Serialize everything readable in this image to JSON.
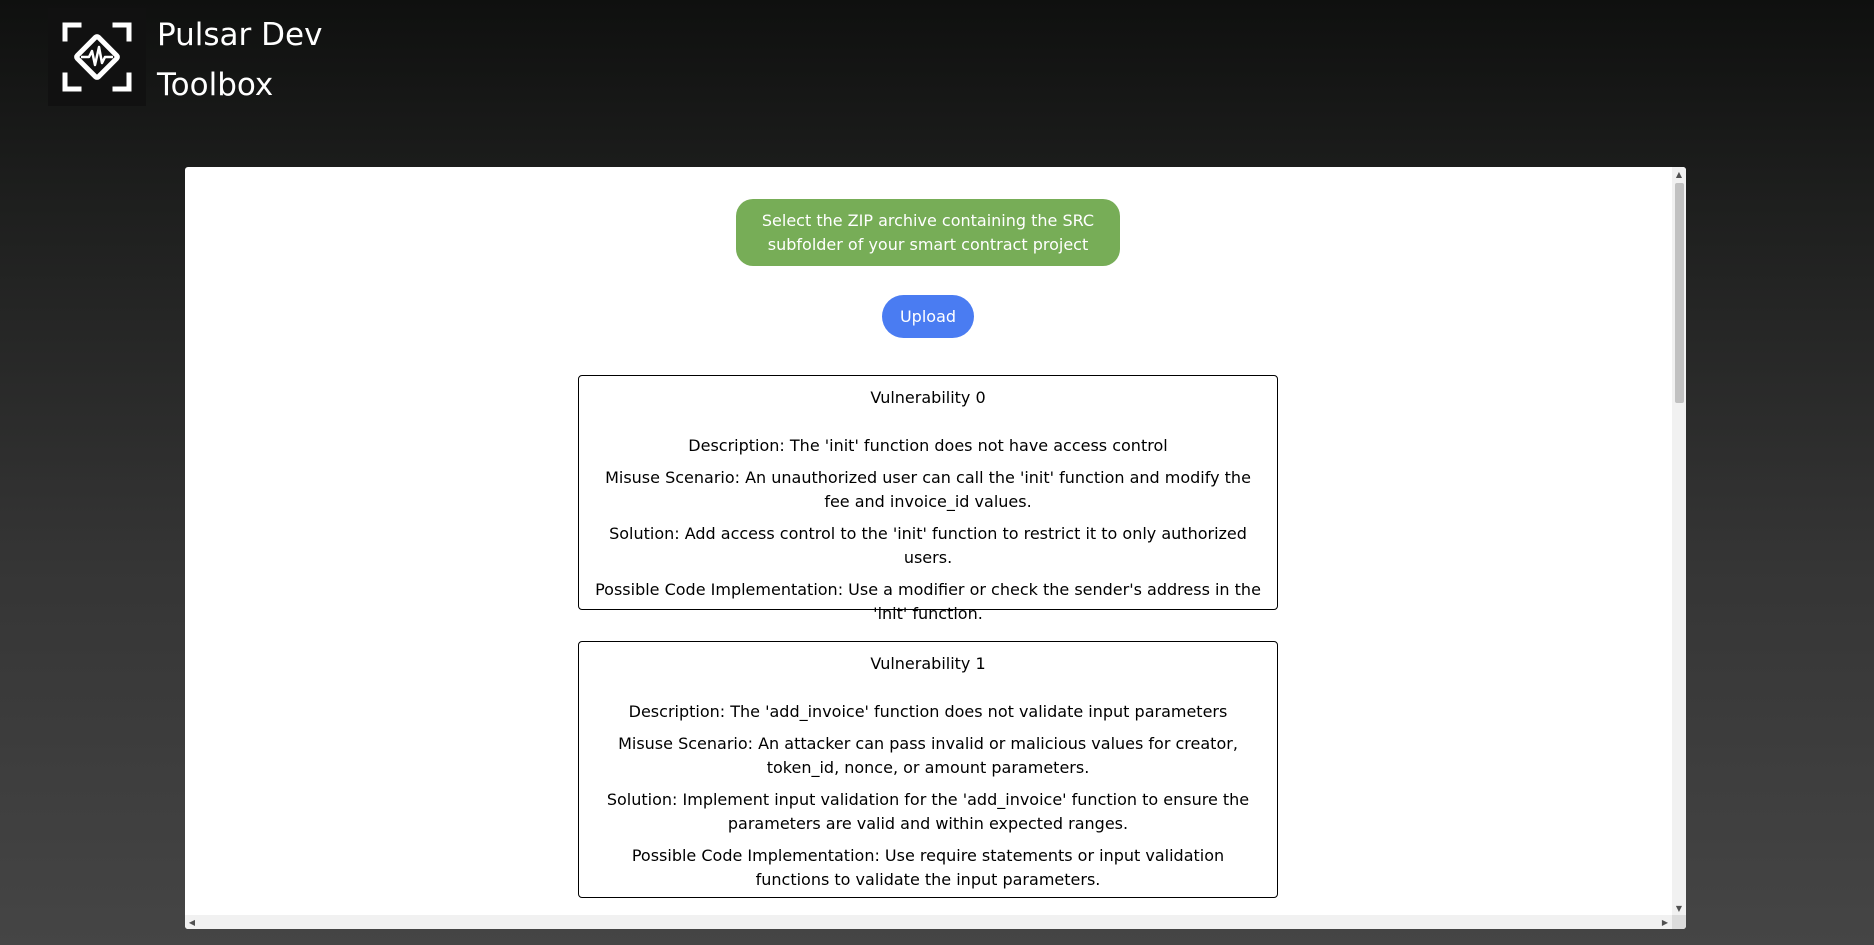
{
  "brand": {
    "name_line1": "Pulsar Dev",
    "name_line2": "Toolbox",
    "logo_icon": "pulse-diamond-icon"
  },
  "main": {
    "hint": "Select the ZIP archive containing the SRC subfolder of your smart contract project",
    "upload_label": "Upload",
    "vulnerabilities": [
      {
        "title": "Vulnerability 0",
        "description": "Description: The 'init' function does not have access control",
        "misuse": "Misuse Scenario: An unauthorized user can call the 'init' function and modify the fee and invoice_id values.",
        "solution": "Solution: Add access control to the 'init' function to restrict it to only authorized users.",
        "code": "Possible Code Implementation: Use a modifier or check the sender's address in the 'init' function."
      },
      {
        "title": "Vulnerability 1",
        "description": "Description: The 'add_invoice' function does not validate input parameters",
        "misuse": "Misuse Scenario: An attacker can pass invalid or malicious values for creator, token_id, nonce, or amount parameters.",
        "solution": "Solution: Implement input validation for the 'add_invoice' function to ensure the parameters are valid and within expected ranges.",
        "code": "Possible Code Implementation: Use require statements or input validation functions to validate the input parameters."
      }
    ]
  },
  "colors": {
    "hint_bg": "#77ad57",
    "upload_bg": "#4a7cf2",
    "panel_bg": "#ffffff"
  }
}
